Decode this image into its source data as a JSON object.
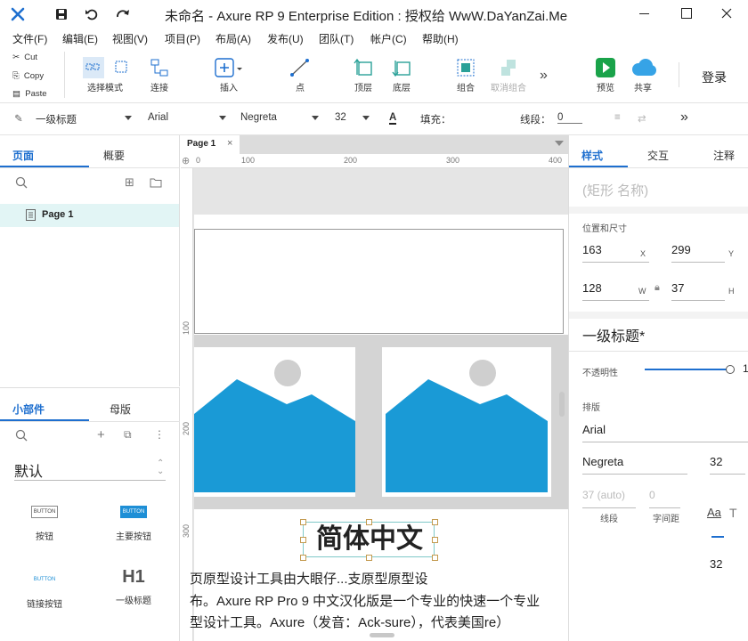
{
  "app": {
    "title": "未命名 - Axure RP 9 Enterprise Edition : 授权给 WwW.DaYanZai.Me"
  },
  "menu": [
    "文件(F)",
    "编辑(E)",
    "视图(V)",
    "项目(P)",
    "布局(A)",
    "发布(U)",
    "团队(T)",
    "帐户(C)",
    "帮助(H)"
  ],
  "clipboard": {
    "cut": "Cut",
    "copy": "Copy",
    "paste": "Paste"
  },
  "toolbar": {
    "select_mode": "选择模式",
    "connect": "连接",
    "insert": "插入",
    "point": "点",
    "top": "顶层",
    "bottom": "底层",
    "group": "组合",
    "ungroup": "取消组合",
    "preview": "预览",
    "share": "共享",
    "login": "登录"
  },
  "format": {
    "style": "一级标题",
    "font": "Arial",
    "weight": "Negreta",
    "size": "32",
    "fill_label": "填充：",
    "stroke_label": "线段：",
    "stroke_value": "0"
  },
  "left": {
    "tabs": {
      "pages": "页面",
      "outline": "概要"
    },
    "page_item": "Page 1",
    "lib_tabs": {
      "widgets": "小部件",
      "masters": "母版"
    },
    "library": "默认",
    "widgets": [
      {
        "preview": "BUTTON",
        "label": "按钮"
      },
      {
        "preview": "BUTTON",
        "label": "主要按钮"
      },
      {
        "preview": "BUTTON",
        "label": "链接按钮"
      },
      {
        "preview": "H1",
        "label": "一级标题"
      }
    ]
  },
  "canvas": {
    "tab": "Page 1",
    "ruler_h": [
      "0",
      "100",
      "200",
      "300",
      "400"
    ],
    "ruler_v": [
      "100",
      "200",
      "300"
    ],
    "heading": "简体中文",
    "body_lines": [
      "页原型设计工具由大眼仔...支原型原型设",
      "布。Axure RP Pro 9 中文汉化版是一个专业的快速一个专业",
      "型设计工具。Axure（发音：Ack-sure），代表美国re）"
    ]
  },
  "right": {
    "tabs": {
      "style": "样式",
      "interact": "交互",
      "notes": "注释"
    },
    "name_placeholder": "(矩形 名称)",
    "pos_label": "位置和尺寸",
    "x": "163",
    "y": "299",
    "w": "128",
    "h": "37",
    "x_unit": "X",
    "y_unit": "Y",
    "w_unit": "W",
    "h_unit": "H",
    "style_name": "一级标题*",
    "opacity_label": "不透明性",
    "opacity": 1.0,
    "opacity_value": "1",
    "typo_label": "排版",
    "font": "Arial",
    "weight": "Negreta",
    "size": "32",
    "line_height": "37 (auto)",
    "char_spacing": "0",
    "line_label": "线段",
    "spacing_label": "字间距",
    "size2": "32"
  },
  "colors": {
    "accent": "#1e6fcf",
    "image_blue": "#1a9ad6",
    "preview_green": "#1aa34a",
    "share_blue": "#36a3e6"
  }
}
